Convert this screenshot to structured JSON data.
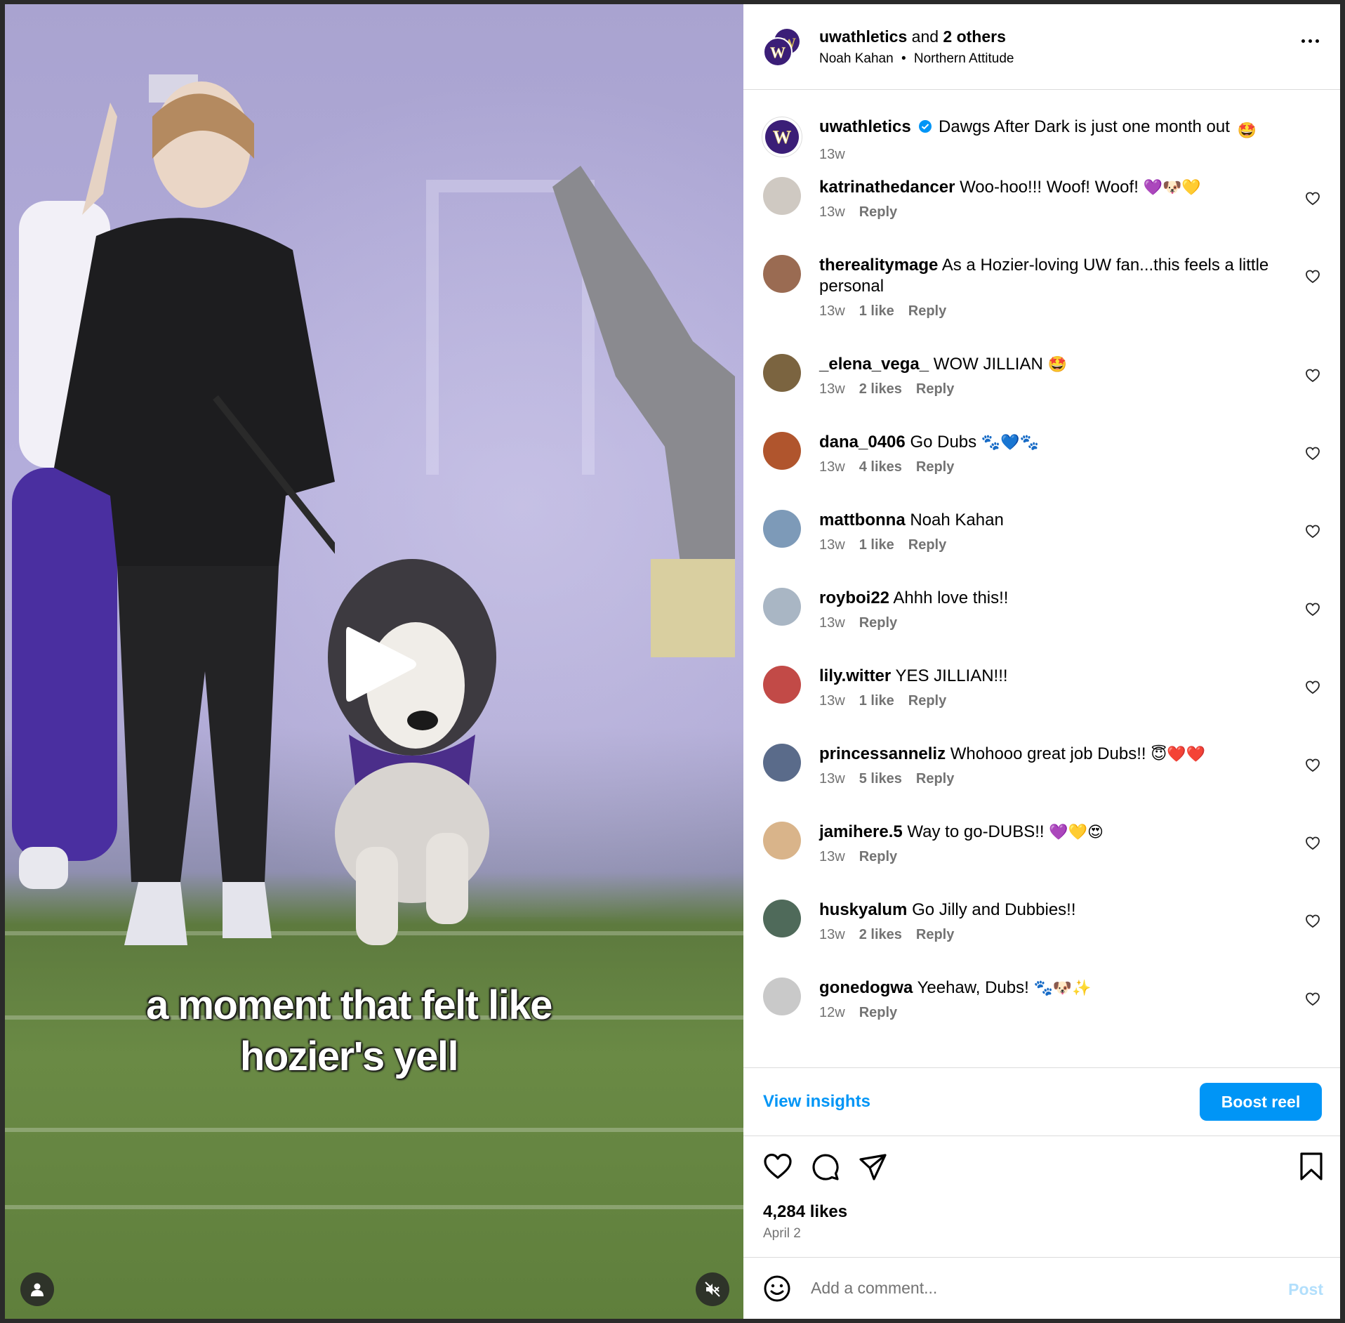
{
  "video": {
    "caption_line1": "a moment that felt like",
    "caption_line2": "hozier's yell",
    "play_icon": "play-icon",
    "user_icon": "user-icon",
    "mute_icon": "muted-speaker-icon"
  },
  "header": {
    "account": "uwathletics",
    "and_text": "and",
    "others": "2 others",
    "artist": "Noah Kahan",
    "dot": "•",
    "song": "Northern Attitude",
    "more_icon": "more-options-icon"
  },
  "caption": {
    "username": "uwathletics",
    "text": "Dawgs After Dark is just one month out",
    "emoji": "🤩",
    "time": "13w"
  },
  "comments": [
    {
      "username": "katrinathedancer",
      "text": "Woo-hoo!!! Woof! Woof!",
      "emoji": "💜🐶💛",
      "time": "13w",
      "likes": "",
      "reply": "Reply",
      "avatar_color": "#cfc9c2"
    },
    {
      "username": "therealitymage",
      "text": "As a Hozier-loving UW fan...this feels a little personal",
      "emoji": "",
      "time": "13w",
      "likes": "1 like",
      "reply": "Reply",
      "avatar_color": "#9a6b52"
    },
    {
      "username": "_elena_vega_",
      "text": "WOW JILLIAN",
      "emoji": "🤩",
      "time": "13w",
      "likes": "2 likes",
      "reply": "Reply",
      "avatar_color": "#7b6440"
    },
    {
      "username": "dana_0406",
      "text": "Go Dubs",
      "emoji": "🐾💙🐾",
      "time": "13w",
      "likes": "4 likes",
      "reply": "Reply",
      "avatar_color": "#b0552d"
    },
    {
      "username": "mattbonna",
      "text": "Noah Kahan",
      "emoji": "",
      "time": "13w",
      "likes": "1 like",
      "reply": "Reply",
      "avatar_color": "#7d9ab8"
    },
    {
      "username": "royboi22",
      "text": "Ahhh love this!!",
      "emoji": "",
      "time": "13w",
      "likes": "",
      "reply": "Reply",
      "avatar_color": "#a9b6c4"
    },
    {
      "username": "lily.witter",
      "text": "YES JILLIAN!!!",
      "emoji": "",
      "time": "13w",
      "likes": "1 like",
      "reply": "Reply",
      "avatar_color": "#c24a47"
    },
    {
      "username": "princessanneliz",
      "text": "Whohooo great job Dubs!!",
      "emoji": "😇❤️❤️",
      "time": "13w",
      "likes": "5 likes",
      "reply": "Reply",
      "avatar_color": "#5a6b8a"
    },
    {
      "username": "jamihere.5",
      "text": "Way to go-DUBS!!",
      "emoji": "💜💛😍",
      "time": "13w",
      "likes": "",
      "reply": "Reply",
      "avatar_color": "#d9b48a"
    },
    {
      "username": "huskyalum",
      "text": "Go Jilly and Dubbies!!",
      "emoji": "",
      "time": "13w",
      "likes": "2 likes",
      "reply": "Reply",
      "avatar_color": "#4f6a5a"
    },
    {
      "username": "gonedogwa",
      "text": "Yeehaw, Dubs!",
      "emoji": "🐾🐶✨",
      "time": "12w",
      "likes": "",
      "reply": "Reply",
      "avatar_color": "#c9c9c9"
    }
  ],
  "insights": {
    "view_label": "View insights",
    "boost_label": "Boost reel"
  },
  "actions": {
    "like_icon": "heart-icon",
    "comment_icon": "comment-icon",
    "share_icon": "send-icon",
    "save_icon": "bookmark-icon"
  },
  "stats": {
    "likes": "4,284 likes",
    "date": "April 2"
  },
  "add_comment": {
    "placeholder": "Add a comment...",
    "post_label": "Post",
    "emoji_icon": "smiley-icon"
  },
  "colors": {
    "accent": "#0095f6",
    "uw_purple": "#3b1e77",
    "muted": "#737373",
    "border": "#dbdbdb"
  }
}
